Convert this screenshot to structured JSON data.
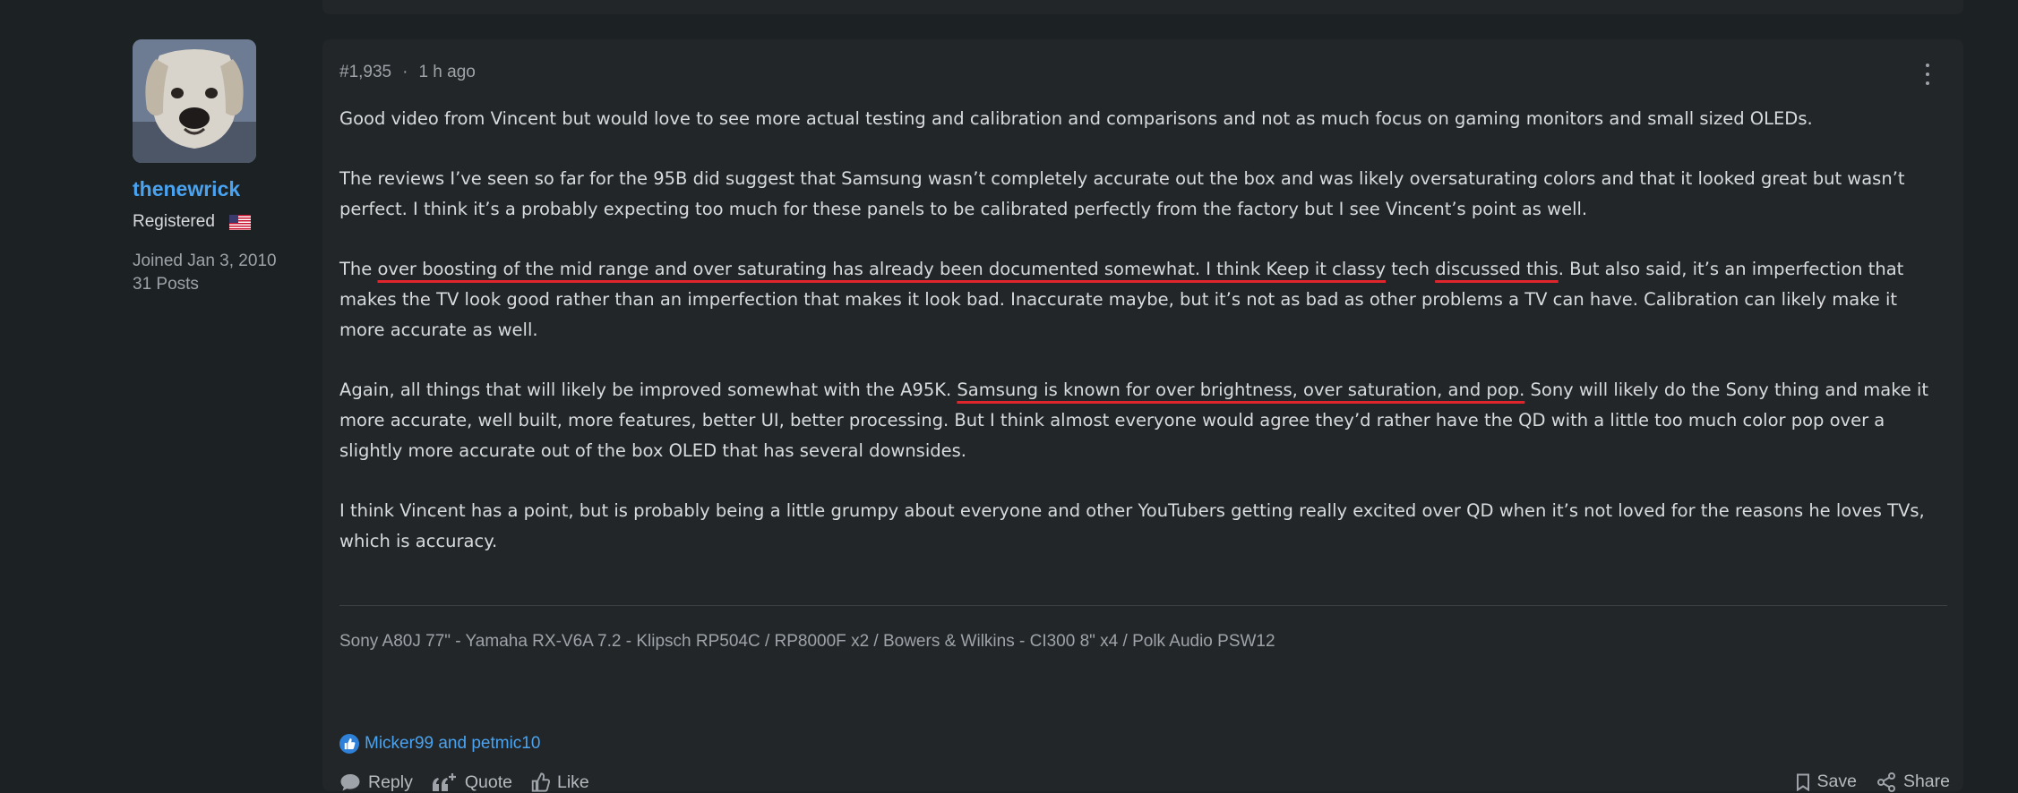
{
  "author": {
    "username": "thenewrick",
    "role": "Registered",
    "joined": "Joined Jan 3, 2010",
    "posts": "31 Posts"
  },
  "post": {
    "number": "#1,935",
    "separator": "·",
    "time": "1 h ago",
    "paragraphs": [
      "Good video from Vincent but would love to see more actual testing and calibration and comparisons and not as much focus on gaming monitors and small sized OLEDs.",
      "The reviews I’ve seen so far for the 95B did suggest that Samsung wasn’t completely accurate out the box and was likely oversaturating colors and that it looked great but wasn’t perfect. I think it’s a probably expecting too much for these panels to be calibrated perfectly from the factory but I see Vincent’s point as well."
    ],
    "p3": {
      "a": "The ",
      "b": "over boosting of the mid range and over saturating has already been documented somewhat. I think Keep it classy",
      "c": " tech ",
      "d": "discussed this",
      "e": ". But also said, it’s an imperfection that makes the TV look good rather than an imperfection that makes it look bad. Inaccurate maybe, but it’s not as bad as other problems a TV can have. Calibration can likely make it more accurate as well."
    },
    "p4": {
      "a": "Again, all things that will likely be improved somewhat with the A95K. ",
      "b": "Samsung is known for over brightness, over saturation, and pop.",
      "c": " Sony will likely do the Sony thing and make it more accurate, well built, more features, better UI, better processing. But I think almost everyone would agree they’d rather have the QD with a little too much color pop over a slightly more accurate out of the box OLED that has several downsides."
    },
    "p5": "I think Vincent has a point, but is probably being a little grumpy about everyone and other YouTubers getting really excited over QD when it’s not loved for the reasons he loves TVs, which is accuracy.",
    "signature": "Sony A80J 77\" - Yamaha RX-V6A 7.2 - Klipsch RP504C / RP8000F x2 / Bowers & Wilkins - CI300 8\" x4 / Polk Audio PSW12",
    "reactions": "Micker99 and petmic10"
  },
  "actions": {
    "reply": "Reply",
    "quote": "Quote",
    "like": "Like",
    "save": "Save",
    "share": "Share"
  },
  "colors": {
    "background": "#1c2123",
    "card": "#222628",
    "link": "#4aa3f0",
    "underline": "#e0252d"
  }
}
